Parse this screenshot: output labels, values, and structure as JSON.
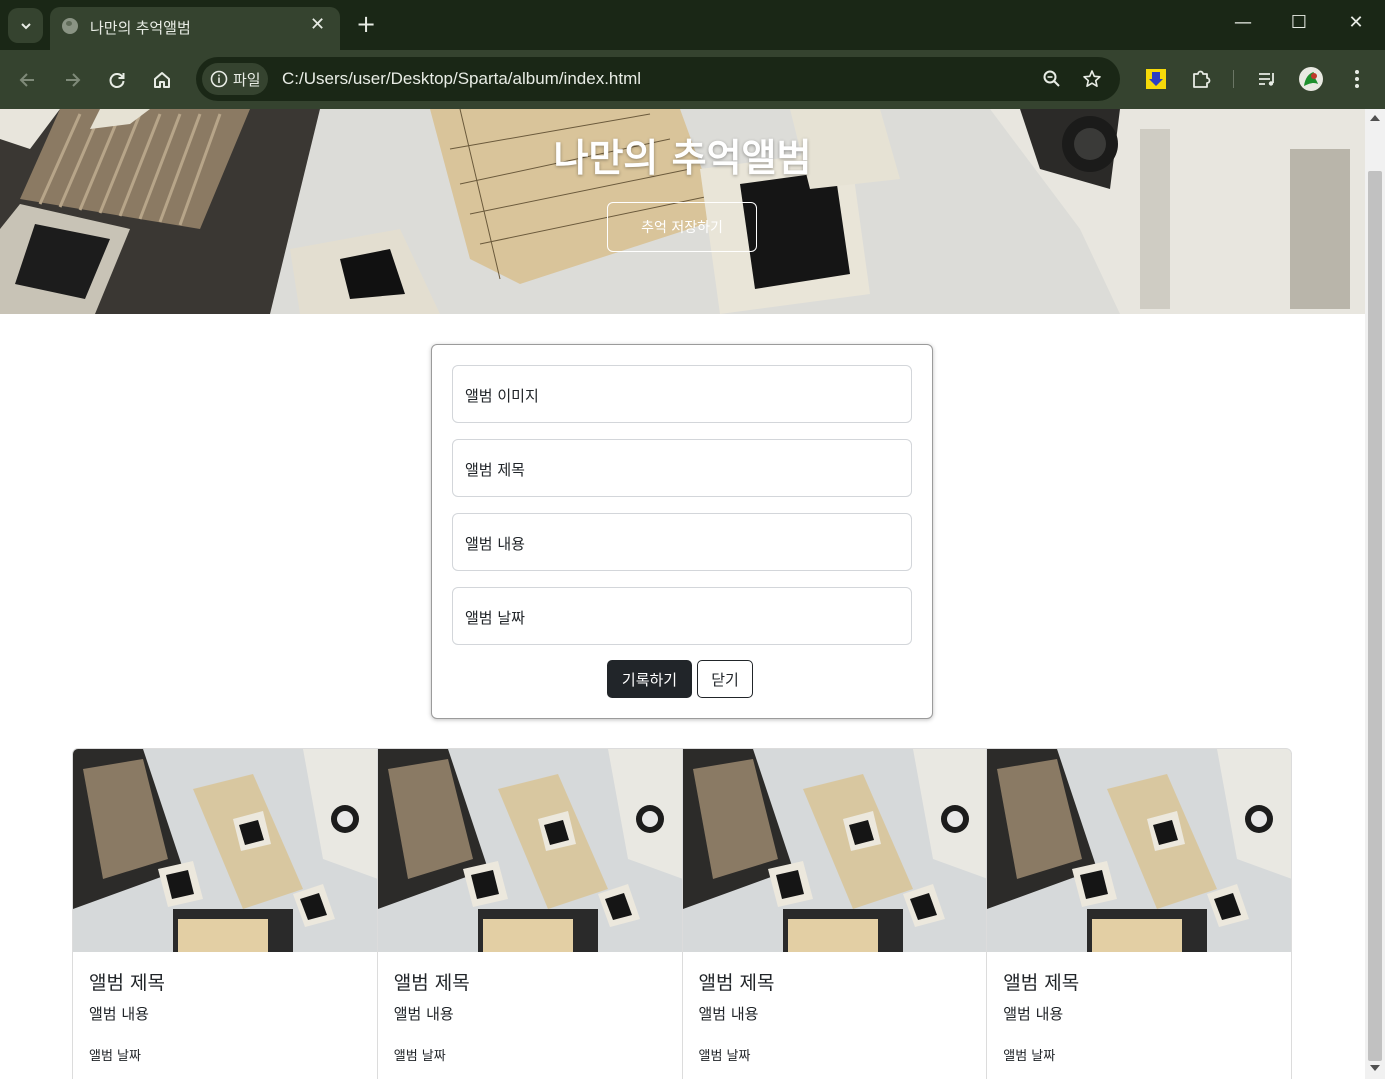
{
  "browser": {
    "tab_title": "나만의 추억앨범",
    "tab_close": "✕",
    "new_tab": "+",
    "window_controls": {
      "minimize": "—",
      "maximize": "☐",
      "close": "✕"
    },
    "site_chip_label": "파일",
    "url": "C:/Users/user/Desktop/Sparta/album/index.html",
    "icons": [
      "tab-search-icon",
      "back-arrow-icon",
      "forward-arrow-icon",
      "reload-icon",
      "home-icon",
      "info-icon",
      "zoom-icon",
      "star-icon",
      "download-extension-icon",
      "puzzle-extensions-icon",
      "media-controls-icon",
      "profile-avatar-icon",
      "kebab-menu-icon"
    ]
  },
  "hero": {
    "title": "나만의 추억앨범",
    "button_label": "추억 저장하기"
  },
  "form": {
    "fields": [
      {
        "label": "앨범 이미지"
      },
      {
        "label": "앨범 제목"
      },
      {
        "label": "앨범 내용"
      },
      {
        "label": "앨범 날짜"
      }
    ],
    "save_label": "기록하기",
    "close_label": "닫기"
  },
  "cards": [
    {
      "title": "앨범 제목",
      "text": "앨범 내용",
      "date": "앨범 날짜"
    },
    {
      "title": "앨범 제목",
      "text": "앨범 내용",
      "date": "앨범 날짜"
    },
    {
      "title": "앨범 제목",
      "text": "앨범 내용",
      "date": "앨범 날짜"
    },
    {
      "title": "앨범 제목",
      "text": "앨범 내용",
      "date": "앨범 날짜"
    }
  ],
  "colors": {
    "chrome_dark": "#1a2716",
    "chrome_mid": "#35432f",
    "button_dark": "#212529",
    "scroll_thumb": "#c1c1c1"
  }
}
